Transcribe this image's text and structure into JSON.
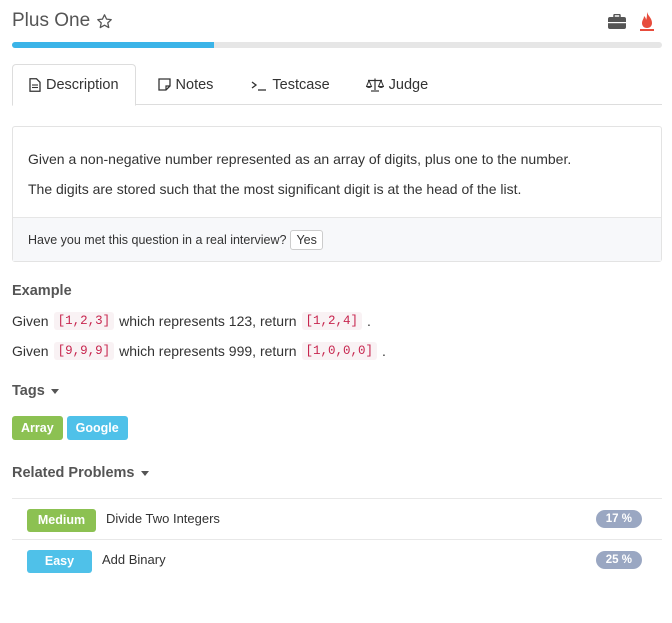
{
  "header": {
    "title": "Plus One",
    "icons": [
      "star-outline-icon",
      "briefcase-icon",
      "fire-icon"
    ]
  },
  "progress": {
    "fraction": 0.31,
    "color": "#3bb4e8"
  },
  "tabs": [
    {
      "label": "Description",
      "icon": "document-icon",
      "active": true
    },
    {
      "label": "Notes",
      "icon": "note-icon",
      "active": false
    },
    {
      "label": "Testcase",
      "icon": "terminal-icon",
      "active": false
    },
    {
      "label": "Judge",
      "icon": "scale-icon",
      "active": false
    }
  ],
  "description": {
    "lines": [
      "Given a non-negative number represented as an array of digits, plus one to the number.",
      "The digits are stored such that the most significant digit is at the head of the list."
    ],
    "interview_question": "Have you met this question in a real interview?",
    "yes_label": "Yes"
  },
  "example": {
    "heading": "Example",
    "lines": [
      {
        "pre": "Given",
        "input": "[1,2,3]",
        "mid": "which represents 123, return",
        "output": "[1,2,4]",
        "post": "."
      },
      {
        "pre": "Given",
        "input": "[9,9,9]",
        "mid": "which represents 999, return",
        "output": "[1,0,0,0]",
        "post": "."
      }
    ]
  },
  "tags": {
    "heading": "Tags",
    "items": [
      {
        "label": "Array",
        "color": "#8cc152"
      },
      {
        "label": "Google",
        "color": "#4fc1e9"
      }
    ]
  },
  "related": {
    "heading": "Related Problems",
    "items": [
      {
        "difficulty": "Medium",
        "difficulty_color": "#8cc152",
        "name": "Divide Two Integers",
        "percent": "17 %"
      },
      {
        "difficulty": "Easy",
        "difficulty_color": "#4fc1e9",
        "name": "Add Binary",
        "percent": "25 %"
      }
    ],
    "percent_color": "#9aa7c2"
  }
}
